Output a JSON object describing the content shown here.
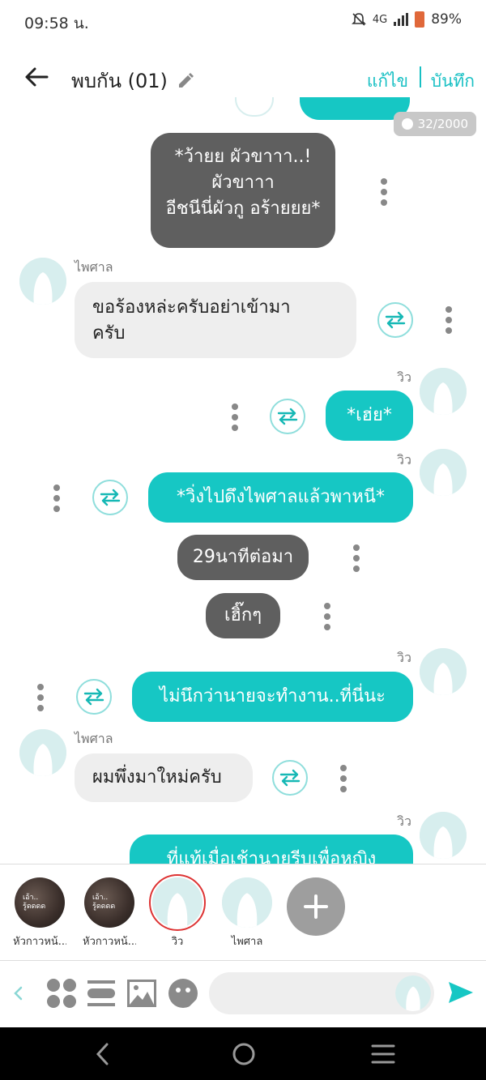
{
  "status": {
    "time": "09:58 น.",
    "network": "4G",
    "battery": "89%"
  },
  "header": {
    "title": "พบกัน (01)",
    "edit_label": "แก้ไข",
    "save_label": "บันทึก"
  },
  "counter": "32/2000",
  "messages": {
    "narr1": {
      "line1": "*ว้ายย ผัวขาาา..!",
      "line2": "ผัวขาาา",
      "line3": "อีชนีนี่ผัวกู อร้ายยย*"
    },
    "m1": {
      "speaker": "ไพศาล",
      "text1": "ขอร้องหล่ะครับอย่าเข้ามา",
      "text2": "ครับ"
    },
    "m2": {
      "speaker": "วิว",
      "text": "*เฮ่ย*"
    },
    "m3": {
      "speaker": "วิว",
      "text": "*วิ่งไปดึงไพศาลแล้วพาหนี*"
    },
    "narr2": {
      "text": "29นาทีต่อมา"
    },
    "narr3": {
      "text": "เฮิ๊กๆ"
    },
    "m4": {
      "speaker": "วิว",
      "text": "ไม่นึกว่านายจะทำงาน..ที่นี่นะ"
    },
    "m5": {
      "speaker": "ไพศาล",
      "text": "ผมพึ่งมาใหม่ครับ"
    },
    "m6": {
      "speaker": "วิว",
      "text": "ที่แท้เมื่อเช้านายรีบเพื่อหญิง"
    }
  },
  "characters": [
    {
      "name": "หัวกาวหน้...",
      "photo_text": "เอ้า..\nรู้ดดดด"
    },
    {
      "name": "หัวกาวหน้...",
      "photo_text": "เอ้า..\nรู้ดดดด"
    },
    {
      "name": "วิว"
    },
    {
      "name": "ไพศาล"
    }
  ],
  "input": {
    "placeholder": ""
  },
  "colors": {
    "accent": "#16c7c4",
    "narration": "#5f5f5f",
    "left_bubble": "#eeeeee"
  }
}
